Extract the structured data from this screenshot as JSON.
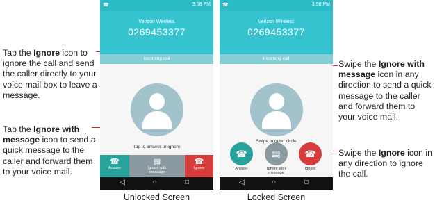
{
  "callouts": {
    "left_top": {
      "pre": "Tap the ",
      "bold": "Ignore",
      "post": " icon to ignore the call and send the caller directly to your voice mail box to leave a message."
    },
    "left_bottom": {
      "pre": "Tap the ",
      "bold": "Ignore with message",
      "post": " icon to send a quick message to the caller and forward them to your voice mail."
    },
    "right_top": {
      "pre": "Swipe the ",
      "bold": "Ignore with message",
      "post": " icon in any direction to send a quick message to the caller and forward them to your voice mail."
    },
    "right_bottom": {
      "pre": "Swipe the ",
      "bold": "Ignore",
      "post": " icon in any direction to ignore the call."
    }
  },
  "phones": {
    "unlocked": {
      "time": "3:58 PM",
      "carrier": "Verizon Wireless",
      "number": "0269453377",
      "incoming": "Incoming call",
      "hint": "Tap to answer or ignore",
      "answer": "Answer",
      "ignore_msg": "Ignore with message",
      "ignore": "Ignore",
      "caption": "Unlocked Screen"
    },
    "locked": {
      "time": "3:58 PM",
      "carrier": "Verizon Wireless",
      "number": "0269453377",
      "incoming": "Incoming call",
      "hint": "Swipe to outer circle",
      "answer": "Answer",
      "ignore_msg": "Ignore with message",
      "ignore": "Ignore",
      "caption": "Locked Screen"
    }
  },
  "icons": {
    "answer": "phone-icon",
    "ignore_msg": "message-icon",
    "ignore": "hang-up-icon",
    "back": "back-icon",
    "home": "home-icon",
    "recent": "recent-apps-icon",
    "contact": "contact-placeholder-icon"
  },
  "colors": {
    "teal": "#34c3cf",
    "answer": "#27a39b",
    "ignore_msg": "#8a9aa0",
    "ignore": "#d63c3c",
    "leader": "#d22b2b"
  }
}
